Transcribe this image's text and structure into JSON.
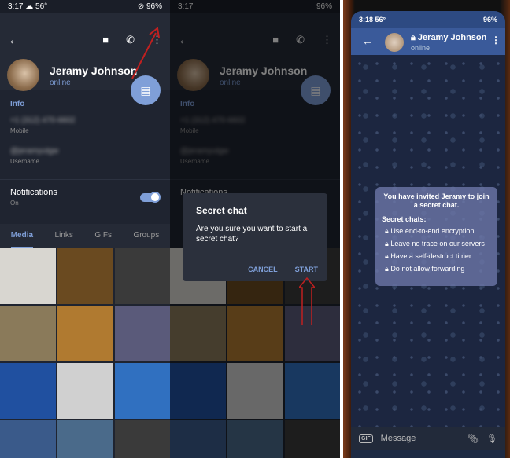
{
  "status1": {
    "time": "3:17",
    "temp": "56°",
    "battery": "96%"
  },
  "status3": {
    "time": "3:18",
    "temp": "56°",
    "battery": "96%"
  },
  "profile": {
    "name": "Jeramy Johnson",
    "status": "online",
    "info_heading": "Info",
    "phone": "+1 (312) 470-6602",
    "phone_label": "Mobile",
    "username": "@jeramyutgw",
    "username_label": "Username",
    "notifications": "Notifications",
    "notifications_state": "On",
    "notifications_on": true
  },
  "tabs": [
    "Media",
    "Links",
    "GIFs",
    "Groups"
  ],
  "dialog": {
    "title": "Secret chat",
    "message": "Are you sure you want to start a secret chat?",
    "cancel": "CANCEL",
    "start": "START"
  },
  "chat": {
    "name": "Jeramy Johnson",
    "status": "online",
    "invite": "You have invited Jeramy to join a secret chat.",
    "heading": "Secret chats:",
    "features": [
      "Use end-to-end encryption",
      "Leave no trace on our servers",
      "Have a self-destruct timer",
      "Do not allow forwarding"
    ],
    "input_placeholder": "Message",
    "gif": "GIF"
  },
  "media_colors": [
    "#d8d6d0",
    "#6a4a20",
    "#3a3a3a",
    "#8a7a5a",
    "#b07a30",
    "#5a5a7a",
    "#2050a0",
    "#d0d0d0",
    "#3070c0",
    "#3a5a8a",
    "#4a6a8a",
    "#3a3a3a"
  ],
  "accent": "#7f9fd8"
}
